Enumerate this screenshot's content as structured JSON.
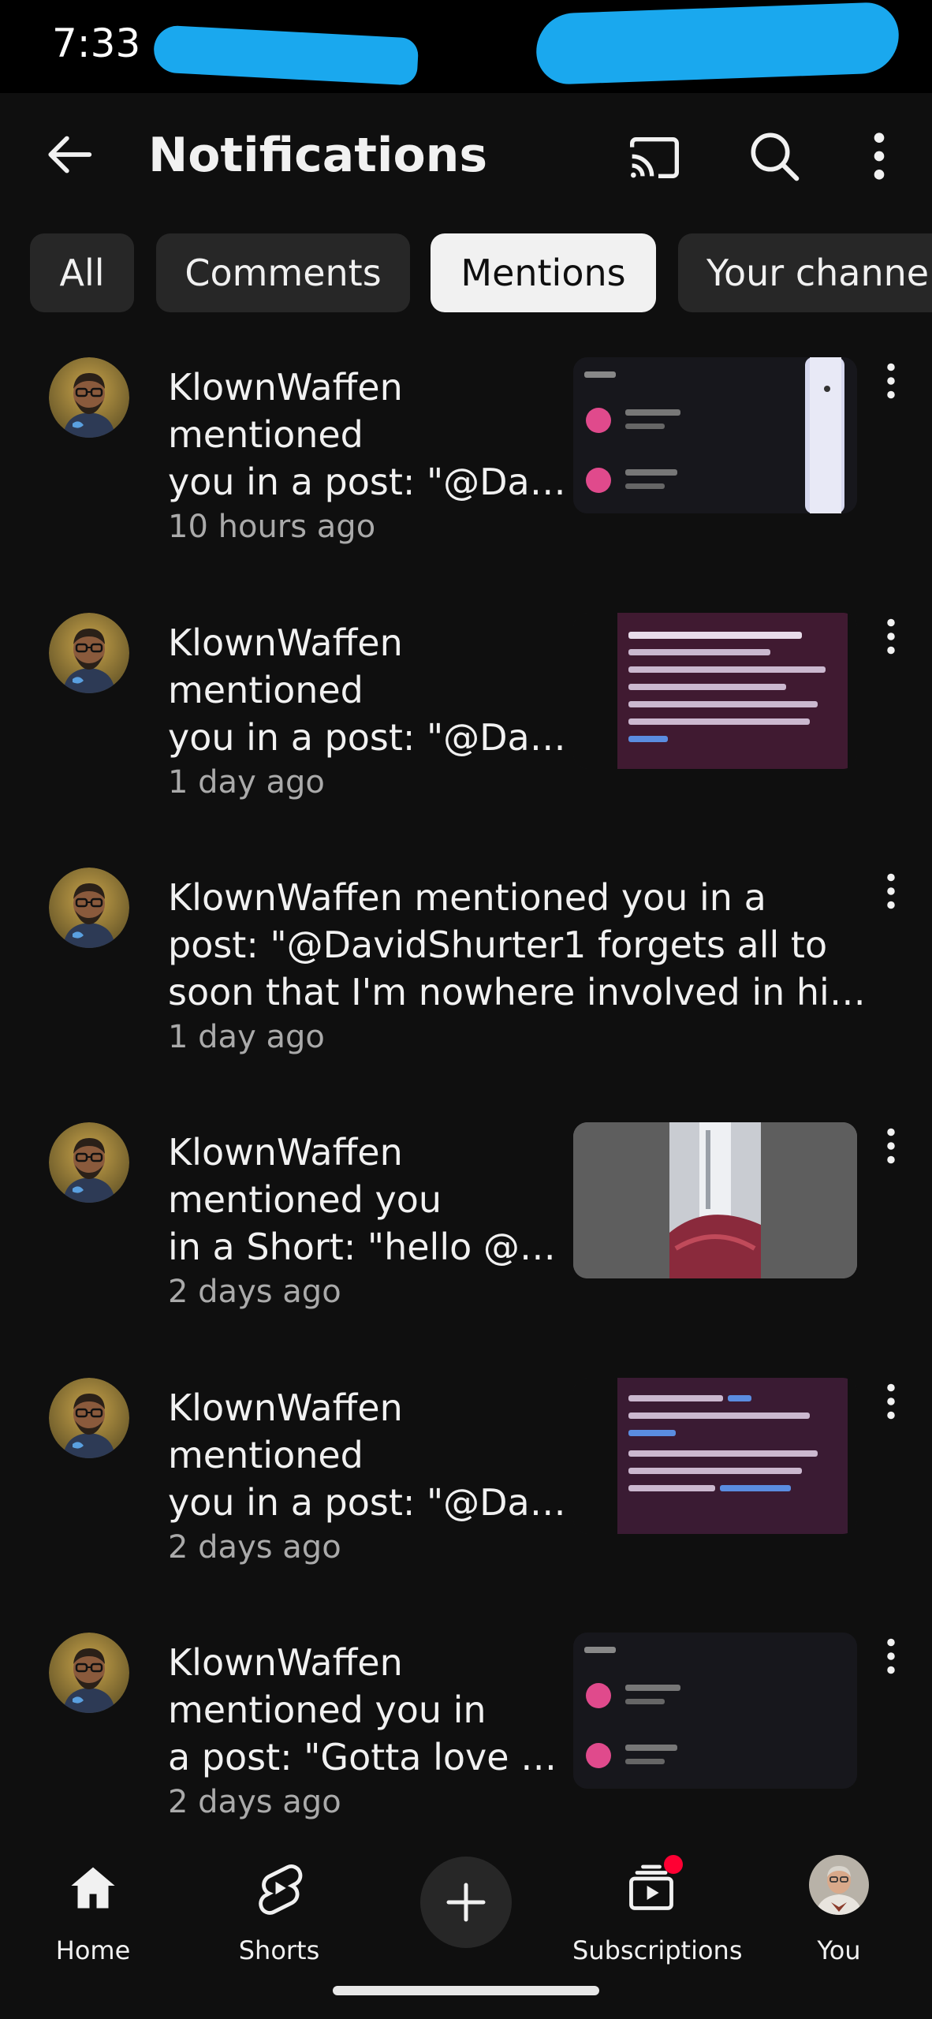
{
  "status_bar": {
    "time": "7:33"
  },
  "header": {
    "title": "Notifications",
    "back_icon": "arrow-left-icon",
    "cast_icon": "cast-icon",
    "search_icon": "search-icon",
    "more_icon": "more-vert-icon"
  },
  "chips": [
    {
      "label": "All",
      "selected": false
    },
    {
      "label": "Comments",
      "selected": false
    },
    {
      "label": "Mentions",
      "selected": true
    },
    {
      "label": "Your channe",
      "selected": false
    }
  ],
  "notifications": [
    {
      "lines": [
        "KlownWaffen",
        "mentioned",
        "you in a post: \"@Da…"
      ],
      "time": "10 hours ago",
      "thumbnail": "screenshot-notification-list"
    },
    {
      "lines": [
        "KlownWaffen",
        "mentioned",
        "you in a post: \"@Da…"
      ],
      "time": "1 day ago",
      "thumbnail": "screenshot-text-list"
    },
    {
      "lines": [
        "KlownWaffen mentioned you in a",
        "post: \"@DavidShurter1 forgets all to",
        "soon that I'm nowhere involved in hi…"
      ],
      "time": "1 day ago",
      "thumbnail": ""
    },
    {
      "lines": [
        "KlownWaffen",
        "mentioned you",
        "in a Short: \"hello @…"
      ],
      "time": "2 days ago",
      "thumbnail": "photo-room"
    },
    {
      "lines": [
        "KlownWaffen",
        "mentioned",
        "you in a post: \"@Da…"
      ],
      "time": "2 days ago",
      "thumbnail": "screenshot-text-list"
    },
    {
      "lines": [
        "KlownWaffen",
        "mentioned you in",
        "a post: \"Gotta love …"
      ],
      "time": "2 days ago",
      "thumbnail": "screenshot-notification-list"
    }
  ],
  "bottom_nav": [
    {
      "label": "Home",
      "icon": "home-icon",
      "active": true
    },
    {
      "label": "Shorts",
      "icon": "shorts-icon",
      "active": false
    },
    {
      "label": "",
      "icon": "plus-icon",
      "active": false
    },
    {
      "label": "Subscriptions",
      "icon": "subscriptions-icon",
      "active": false,
      "badge": true
    },
    {
      "label": "You",
      "icon": "avatar",
      "active": false
    }
  ],
  "colors": {
    "background": "#0f0f0f",
    "chip": "#272727",
    "chip_active": "#f1f1f1",
    "secondary_text": "#aaaaaa",
    "badge": "#ff0033",
    "redaction": "#1aa8ee"
  }
}
